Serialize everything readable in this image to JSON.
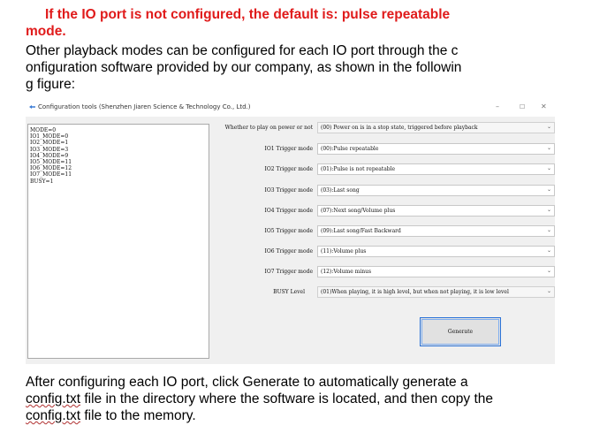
{
  "doc": {
    "red_line1": "If the IO port is not configured, the default is: pulse repeatable",
    "red_line2": "mode.",
    "intro_line1": "Other playback modes can be configured for each IO port through the c",
    "intro_line2": "onfiguration software provided by our company, as shown in the followin",
    "intro_line3": "g figure:",
    "bottom_line1": "After configuring each IO port, click Generate to automatically generate a",
    "bottom_line2a": "config.txt",
    "bottom_line2b": " file in the directory where the software is located, and then copy the",
    "bottom_line3a": "config.txt",
    "bottom_line3b": " file to the memory."
  },
  "window": {
    "title": "Configuration tools (Shenzhen Jiaren Science & Technology Co., Ltd.)",
    "min": "–",
    "max": "☐",
    "close": "✕",
    "mode_list": [
      "MODE=0",
      "IO1_MODE=0",
      "IO2_MODE=1",
      "IO3_MODE=3",
      "IO4_MODE=9",
      "IO5_MODE=11",
      "IO6_MODE=12",
      "IO7_MODE=11",
      "BUSY=1"
    ],
    "rows": [
      {
        "label": "Whether to play on power or not",
        "value": "(00) Power on is in a stop state, triggered before playback"
      },
      {
        "label": "IO1 Trigger mode",
        "value": "(00):Pulse repeatable"
      },
      {
        "label": "IO2 Trigger mode",
        "value": "(01):Pulse is not repeatable"
      },
      {
        "label": "IO3 Trigger mode",
        "value": "(03):Last song"
      },
      {
        "label": "IO4 Trigger mode",
        "value": "(07):Next song/Volume plus"
      },
      {
        "label": "IO5 Trigger mode",
        "value": "(09):Last song/Fast Backward"
      },
      {
        "label": "IO6 Trigger mode",
        "value": "(11):Volume plus"
      },
      {
        "label": "IO7 Trigger mode",
        "value": "(12):Volume minus"
      },
      {
        "label": "BUSY Level",
        "value": "(01)When playing, it is high level, but when not playing, it is low level"
      }
    ],
    "arrow": "⌄",
    "generate": "Generate"
  }
}
